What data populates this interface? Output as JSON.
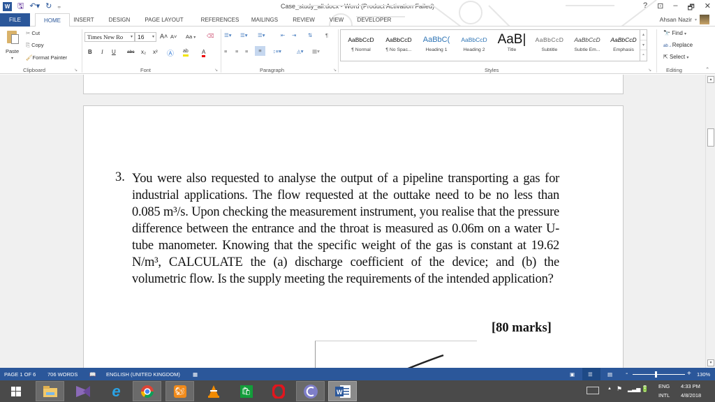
{
  "titlebar": {
    "title": "Case_study_all.docx - Word (Product Activation Failed)",
    "qat": {
      "save_icon": "save-icon",
      "undo_icon": "undo-icon",
      "redo_icon": "redo-icon",
      "customize_icon": "customize-qat-icon"
    },
    "controls": {
      "help": "?",
      "ribbon_display": "⊡",
      "minimize": "–",
      "restore": "🗗",
      "close": "✕"
    }
  },
  "tabs": [
    "FILE",
    "HOME",
    "INSERT",
    "DESIGN",
    "PAGE LAYOUT",
    "REFERENCES",
    "MAILINGS",
    "REVIEW",
    "VIEW",
    "DEVELOPER"
  ],
  "active_tab": "HOME",
  "user": {
    "name": "Ahsan Nazir",
    "chevron": "▾"
  },
  "ribbon": {
    "clipboard": {
      "label": "Clipboard",
      "paste": "Paste",
      "paste_chevron": "▾",
      "cut": "Cut",
      "copy": "Copy",
      "format_painter": "Format Painter"
    },
    "font": {
      "label": "Font",
      "font_name": "Times New Ro",
      "font_size": "16",
      "change_case": "Aa",
      "bold": "B",
      "italic": "I",
      "underline": "U",
      "strike": "abc",
      "subscript": "x₂",
      "superscript": "x²",
      "grow": "A˄",
      "shrink": "A˅"
    },
    "paragraph": {
      "label": "Paragraph",
      "pilcrow": "¶"
    },
    "styles": {
      "label": "Styles",
      "items": [
        {
          "preview": "AaBbCcD",
          "name": "¶ Normal"
        },
        {
          "preview": "AaBbCcD",
          "name": "¶ No Spac..."
        },
        {
          "preview": "AaBbC(",
          "name": "Heading 1"
        },
        {
          "preview": "AaBbCcD",
          "name": "Heading 2"
        },
        {
          "preview": "AaB|",
          "name": "Title"
        },
        {
          "preview": "AaBbCcD",
          "name": "Subtitle"
        },
        {
          "preview": "AaBbCcD",
          "name": "Subtle Em..."
        },
        {
          "preview": "AaBbCcD",
          "name": "Emphasis"
        }
      ]
    },
    "editing": {
      "label": "Editing",
      "find": "Find",
      "replace": "Replace",
      "select": "Select",
      "collapse": "⌃"
    }
  },
  "document": {
    "question_number": "3.",
    "question_text": "You were also requested to analyse the output of a pipeline transporting a gas for industrial applications. The flow requested at the outtake need to be no less than 0.085 m³/s. Upon checking the measurement instrument, you realise that the pressure difference between the entrance and the throat is measured as 0.06m on a water U-tube manometer. Knowing that the specific weight of the gas is constant at 19.62 N/m³, CALCULATE the (a) discharge coefficient of the device; and (b) the volumetric flow. Is the supply meeting the requirements of the intended application?",
    "marks": "[80 marks]"
  },
  "statusbar": {
    "page": "PAGE 1 OF 6",
    "words": "706 WORDS",
    "language": "ENGLISH (UNITED KINGDOM)",
    "zoom_minus": "-",
    "zoom_plus": "+",
    "zoom_level": "130%",
    "zoom_fraction": 0.44
  },
  "taskbar": {
    "apps": [
      "start",
      "file-explorer",
      "visual-studio",
      "internet-explorer",
      "chrome",
      "uc-browser",
      "vlc",
      "store",
      "opera",
      "bittorrent",
      "word"
    ],
    "tray": {
      "lang_top": "ENG",
      "lang_bottom": "INTL",
      "time": "4:33 PM",
      "date": "4/8/2018"
    }
  },
  "colors": {
    "word_blue": "#2b579a",
    "taskbar": "#4a4a4a"
  }
}
